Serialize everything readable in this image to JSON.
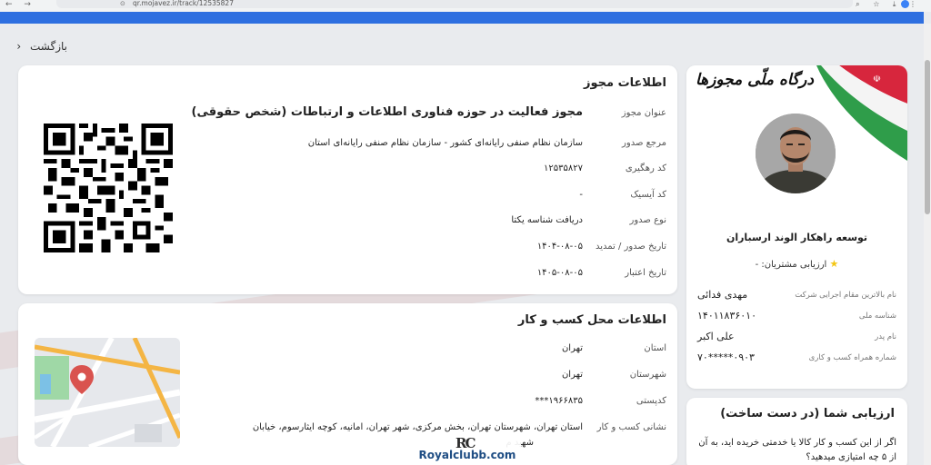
{
  "browser": {
    "url": "qr.mojavez.ir/track/12535827"
  },
  "page": {
    "back_label": "بازگشت"
  },
  "license": {
    "section_title": "اطلاعات مجوز",
    "rows": [
      {
        "label": "عنوان مجوز",
        "value": "مجوز فعالیت در حوزه فناوری اطلاعات و ارتباطات (شخص حقوقی)"
      },
      {
        "label": "مرجع صدور",
        "value": "سازمان نظام صنفی رایانه‌ای کشور - سازمان نظام صنفی رایانه‌ای استان"
      },
      {
        "label": "کد رهگیری",
        "value": "۱۲۵۳۵۸۲۷"
      },
      {
        "label": "کد آیسیک",
        "value": "-"
      },
      {
        "label": "نوع صدور",
        "value": "دریافت شناسه یکتا"
      },
      {
        "label": "تاریخ صدور / تمدید",
        "value": "۱۴۰۴-۰۸-۰۵"
      },
      {
        "label": "تاریخ اعتبار",
        "value": "۱۴۰۵-۰۸-۰۵"
      }
    ]
  },
  "business": {
    "section_title": "اطلاعات محل کسب و کار",
    "rows": [
      {
        "label": "استان",
        "value": "تهران"
      },
      {
        "label": "شهرستان",
        "value": "تهران"
      },
      {
        "label": "کدپستی",
        "value": "۱۹۶۶۸۳۵***"
      },
      {
        "label": "نشانی کسب و کار",
        "value": "استان تهران، شهرستان تهران، بخش مرکزی، شهر تهران، امانیه، کوچه ایثارسوم، خیابان"
      },
      {
        "label": "",
        "value": "شهید م"
      }
    ]
  },
  "profile": {
    "brand": "درگاه ملّی مجوزها",
    "company_name": "توسعه راهکار الوند ارسباران",
    "rating_label": "ارزیابی مشتریان: -",
    "rows": [
      {
        "label": "نام بالاترین مقام اجرایی شرکت",
        "value": "مهدی فدائی"
      },
      {
        "label": "شناسه ملی",
        "value": "۱۴۰۱۱۸۳۶۰۱۰"
      },
      {
        "label": "نام پدر",
        "value": "علی اکبر"
      },
      {
        "label": "شماره همراه کسب و کاری",
        "value": "۰۹۰۳*****۷۰"
      }
    ]
  },
  "rating": {
    "title": "ارزیابی شما (در دست ساخت)",
    "question": "اگر از این کسب و کار کالا یا خدمتی خریده اید، به آن از ۵ چه امتیازی میدهید؟"
  },
  "watermark": {
    "logo": "RC",
    "text": "Royalclubb.com"
  },
  "icons": {
    "back": "chevron-left-icon",
    "star": "star-icon",
    "location": "map-pin-icon"
  },
  "colors": {
    "header_blue": "#2e6fe0",
    "map_pin": "#d9534f",
    "star": "#f3c614"
  }
}
